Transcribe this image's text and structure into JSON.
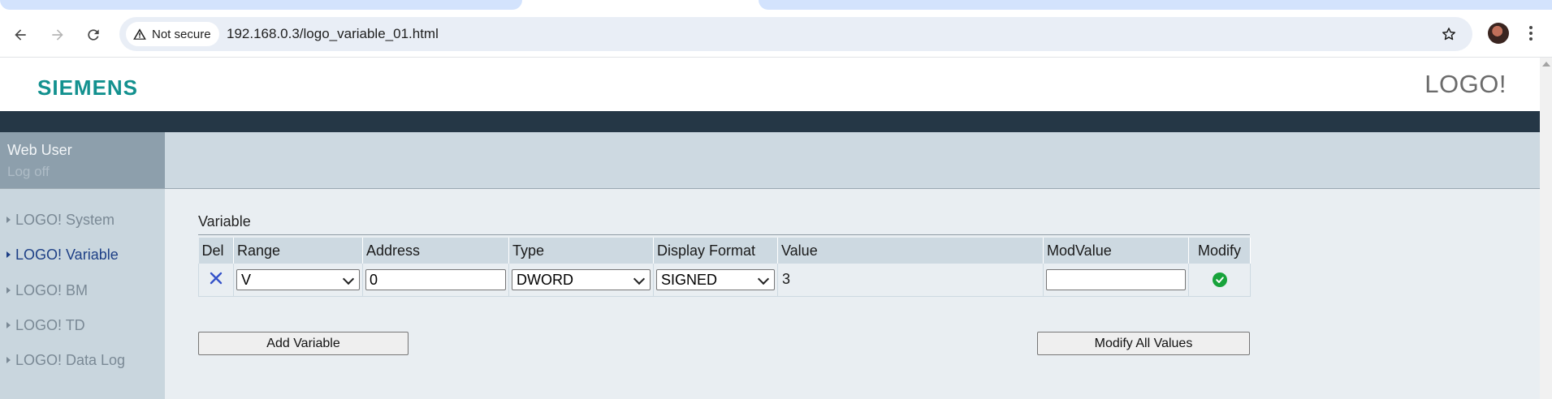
{
  "browser": {
    "security_label": "Not secure",
    "url": "192.168.0.3/logo_variable_01.html"
  },
  "header": {
    "brand": "SIEMENS",
    "product": "LOGO!"
  },
  "user": {
    "name": "Web User",
    "logoff": "Log off"
  },
  "sidebar": {
    "items": [
      {
        "label": "LOGO! System"
      },
      {
        "label": "LOGO! Variable"
      },
      {
        "label": "LOGO! BM"
      },
      {
        "label": "LOGO! TD"
      },
      {
        "label": "LOGO! Data Log"
      }
    ]
  },
  "main": {
    "section_title": "Variable",
    "columns": [
      "Del",
      "Range",
      "Address",
      "Type",
      "Display Format",
      "Value",
      "ModValue",
      "Modify"
    ],
    "rows": [
      {
        "range": "V",
        "address": "0",
        "type": "DWORD",
        "display_format": "SIGNED",
        "value": "3",
        "mod_value": ""
      }
    ],
    "add_button": "Add Variable",
    "modify_all_button": "Modify All Values"
  },
  "colors": {
    "siemens_teal": "#13918f",
    "dark_band": "#253746",
    "active_nav": "#1d3f86",
    "check_green": "#17a33b"
  }
}
